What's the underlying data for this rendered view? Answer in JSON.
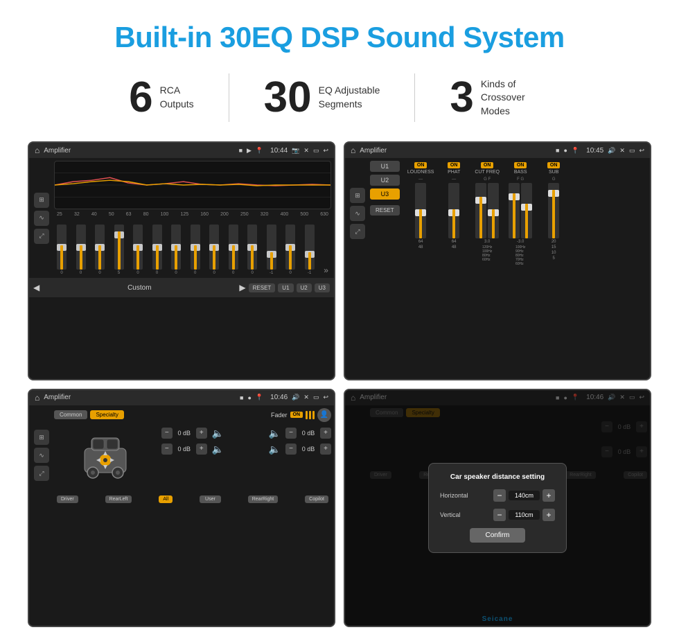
{
  "header": {
    "title": "Built-in 30EQ DSP Sound System"
  },
  "stats": [
    {
      "number": "6",
      "text": "RCA\nOutputs"
    },
    {
      "number": "30",
      "text": "EQ Adjustable\nSegments"
    },
    {
      "number": "3",
      "text": "Kinds of\nCrossover Modes"
    }
  ],
  "screens": {
    "eq": {
      "title": "Amplifier",
      "time": "10:44",
      "frequencies": [
        "25",
        "32",
        "40",
        "50",
        "63",
        "80",
        "100",
        "125",
        "160",
        "200",
        "250",
        "320",
        "400",
        "500",
        "630"
      ],
      "values": [
        0,
        0,
        0,
        5,
        0,
        0,
        0,
        0,
        0,
        0,
        0,
        -1,
        0,
        -1
      ],
      "presets": [
        "Custom",
        "RESET",
        "U1",
        "U2",
        "U3"
      ]
    },
    "crossover": {
      "title": "Amplifier",
      "time": "10:45",
      "bands": [
        "U1",
        "U2",
        "U3"
      ],
      "activeBand": "U3",
      "controls": [
        {
          "label": "LOUDNESS",
          "on": true
        },
        {
          "label": "PHAT",
          "on": true
        },
        {
          "label": "CUT FREQ",
          "on": true
        },
        {
          "label": "BASS",
          "on": true
        },
        {
          "label": "SUB",
          "on": true
        }
      ]
    },
    "fader": {
      "title": "Amplifier",
      "time": "10:46",
      "tabs": [
        "Common",
        "Specialty"
      ],
      "activeTab": "Specialty",
      "faderLabel": "Fader",
      "faderOn": "ON",
      "positions": {
        "topLeft": "0 dB",
        "topRight": "0 dB",
        "bottomLeft": "0 dB",
        "bottomRight": "0 dB"
      },
      "zones": [
        "Driver",
        "RearLeft",
        "All",
        "User",
        "RearRight",
        "Copilot"
      ],
      "activeZone": "All"
    },
    "distance": {
      "title": "Amplifier",
      "time": "10:46",
      "dialogTitle": "Car speaker distance setting",
      "horizontal": {
        "label": "Horizontal",
        "value": "140cm"
      },
      "vertical": {
        "label": "Vertical",
        "value": "110cm"
      },
      "confirmBtn": "Confirm",
      "positions": {
        "topRight": "0 dB",
        "bottomRight": "0 dB"
      },
      "zones": [
        "Driver",
        "RearLeft",
        "All",
        "User",
        "RearRight",
        "Copilot"
      ]
    }
  },
  "watermark": "Seicane"
}
